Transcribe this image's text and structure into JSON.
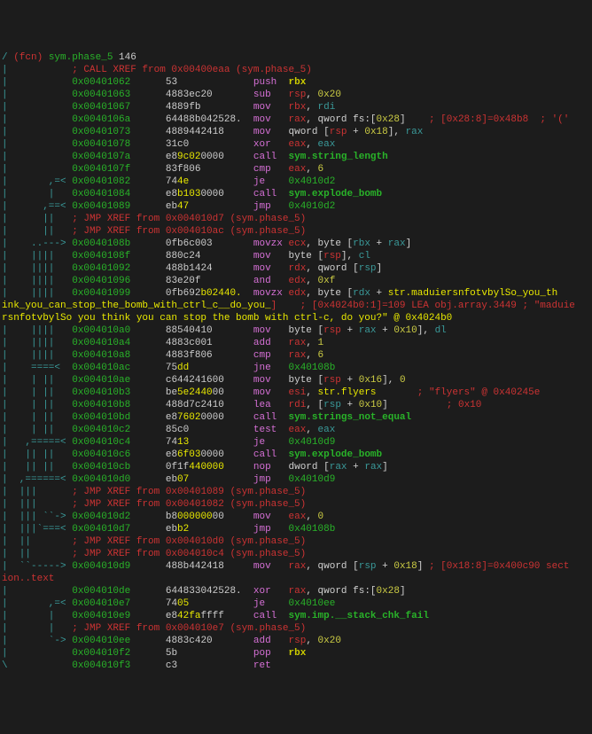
{
  "chart_data": null,
  "lines": [
    {
      "g": "/ ",
      "p": "(fcn) ",
      "nm": "sym.phase_5",
      "sz": " 146",
      "c": "fname"
    },
    {
      "g": "|           ",
      "x": "; CALL XREF from 0x00400eaa (sym.phase_5)",
      "c": "cmt"
    },
    {
      "g": "|           ",
      "a": "0x00401062",
      "h": "53",
      "m": "push",
      "ops": [
        {
          "t": "rbx",
          "c": "bb"
        }
      ]
    },
    {
      "g": "|           ",
      "a": "0x00401063",
      "h": "4883ec20",
      "m": "sub",
      "ops": [
        {
          "t": "rsp",
          "c": "regm"
        },
        {
          "t": ", ",
          "c": "op"
        },
        {
          "t": "0x20",
          "c": "num"
        }
      ]
    },
    {
      "g": "|           ",
      "a": "0x00401067",
      "h": "4889fb",
      "m": "mov",
      "ops": [
        {
          "t": "rbx",
          "c": "regm"
        },
        {
          "t": ", ",
          "c": "op"
        },
        {
          "t": "rdi",
          "c": "reg"
        }
      ]
    },
    {
      "g": "|           ",
      "a": "0x0040106a",
      "h": "64488b042528.",
      "m": "mov",
      "ops": [
        {
          "t": "rax",
          "c": "regm"
        },
        {
          "t": ", qword fs:[",
          "c": "op"
        },
        {
          "t": "0x28",
          "c": "num"
        },
        {
          "t": "]",
          "c": "op"
        }
      ],
      "cm": "    ; [0x28:8]=0x48b8  ; '('"
    },
    {
      "g": "|           ",
      "a": "0x00401073",
      "h": "4889442418",
      "m": "mov",
      "ops": [
        {
          "t": "qword [",
          "c": "op"
        },
        {
          "t": "rsp",
          "c": "regm"
        },
        {
          "t": " + ",
          "c": "op"
        },
        {
          "t": "0x18",
          "c": "num"
        },
        {
          "t": "], ",
          "c": "op"
        },
        {
          "t": "rax",
          "c": "reg"
        }
      ]
    },
    {
      "g": "|           ",
      "a": "0x00401078",
      "h": "31c0",
      "m": "xor",
      "ops": [
        {
          "t": "eax",
          "c": "regm"
        },
        {
          "t": ", ",
          "c": "op"
        },
        {
          "t": "eax",
          "c": "reg"
        }
      ]
    },
    {
      "g": "|           ",
      "a": "0x0040107a",
      "h": "e8",
      "h2": "9c02",
      "h3": "0000",
      "m": "call",
      "ops": [
        {
          "t": "sym.string_length",
          "c": "call"
        }
      ]
    },
    {
      "g": "|           ",
      "a": "0x0040107f",
      "h": "83f806",
      "m": "cmp",
      "ops": [
        {
          "t": "eax",
          "c": "regm"
        },
        {
          "t": ", ",
          "c": "op"
        },
        {
          "t": "6",
          "c": "num"
        }
      ]
    },
    {
      "g": "|       ,=< ",
      "a": "0x00401082",
      "h": "74",
      "h2": "4e",
      "m": "je",
      "ops": [
        {
          "t": "0x4010d2",
          "c": "jmp"
        }
      ]
    },
    {
      "g": "|       |   ",
      "a": "0x00401084",
      "h": "e8",
      "h2": "b103",
      "h3": "0000",
      "m": "call",
      "ops": [
        {
          "t": "sym.explode_bomb",
          "c": "call"
        }
      ]
    },
    {
      "g": "|      ,==< ",
      "a": "0x00401089",
      "h": "eb",
      "h2": "47",
      "m": "jmp",
      "ops": [
        {
          "t": "0x4010d2",
          "c": "jmp"
        }
      ]
    },
    {
      "g": "|      ||   ",
      "x": "; JMP XREF from 0x004010d7 (sym.phase_5)",
      "c": "cmt"
    },
    {
      "g": "|      ||   ",
      "x": "; JMP XREF from 0x004010ac (sym.phase_5)",
      "c": "cmt"
    },
    {
      "g": "|    ..---> ",
      "a": "0x0040108b",
      "h": "0fb6c003",
      "m": "movzx",
      "ops": [
        {
          "t": "ecx",
          "c": "regm"
        },
        {
          "t": ", byte [",
          "c": "op"
        },
        {
          "t": "rbx",
          "c": "reg"
        },
        {
          "t": " + ",
          "c": "op"
        },
        {
          "t": "rax",
          "c": "reg"
        },
        {
          "t": "]",
          "c": "op"
        }
      ]
    },
    {
      "g": "|    ||||   ",
      "a": "0x0040108f",
      "h": "880c24",
      "m": "mov",
      "ops": [
        {
          "t": "byte [",
          "c": "op"
        },
        {
          "t": "rsp",
          "c": "regm"
        },
        {
          "t": "], ",
          "c": "op"
        },
        {
          "t": "cl",
          "c": "reg"
        }
      ]
    },
    {
      "g": "|    ||||   ",
      "a": "0x00401092",
      "h": "488b1424",
      "m": "mov",
      "ops": [
        {
          "t": "rdx",
          "c": "regm"
        },
        {
          "t": ", qword [",
          "c": "op"
        },
        {
          "t": "rsp",
          "c": "reg"
        },
        {
          "t": "]",
          "c": "op"
        }
      ]
    },
    {
      "g": "|    ||||   ",
      "a": "0x00401096",
      "h": "83e20f",
      "m": "and",
      "ops": [
        {
          "t": "edx",
          "c": "regm"
        },
        {
          "t": ", ",
          "c": "op"
        },
        {
          "t": "0xf",
          "c": "num"
        }
      ]
    },
    {
      "g": "|    ||||   ",
      "a": "0x00401099",
      "h": "0fb692",
      "h2": "b02440.",
      "m": "movzx",
      "ops": [
        {
          "t": "edx",
          "c": "regm"
        },
        {
          "t": ", byte [",
          "c": "op"
        },
        {
          "t": "rdx",
          "c": "reg"
        },
        {
          "t": " + ",
          "c": "op"
        },
        {
          "t": "str.maduiersnfotvbylSo_you_th",
          "c": "str"
        }
      ]
    },
    {
      "raw1": "ink_you_can_stop_the_bomb_with_ctrl_c__do_you_",
      "raw2": "]    ; [0x4024b0:1]=109 LEA obj.array.3449 ; \"maduie"
    },
    {
      "raw1": "rsnfotvbylSo you think you can stop the bomb with ctrl-c, do you?\" @ 0x4024b0"
    },
    {
      "g": "|    ||||   ",
      "a": "0x004010a0",
      "h": "88540410",
      "m": "mov",
      "ops": [
        {
          "t": "byte [",
          "c": "op"
        },
        {
          "t": "rsp",
          "c": "regm"
        },
        {
          "t": " + ",
          "c": "op"
        },
        {
          "t": "rax",
          "c": "reg"
        },
        {
          "t": " + ",
          "c": "op"
        },
        {
          "t": "0x10",
          "c": "num"
        },
        {
          "t": "], ",
          "c": "op"
        },
        {
          "t": "dl",
          "c": "reg"
        }
      ]
    },
    {
      "g": "|    ||||   ",
      "a": "0x004010a4",
      "h": "4883c001",
      "m": "add",
      "ops": [
        {
          "t": "rax",
          "c": "regm"
        },
        {
          "t": ", ",
          "c": "op"
        },
        {
          "t": "1",
          "c": "num"
        }
      ]
    },
    {
      "g": "|    ||||   ",
      "a": "0x004010a8",
      "h": "4883f806",
      "m": "cmp",
      "ops": [
        {
          "t": "rax",
          "c": "regm"
        },
        {
          "t": ", ",
          "c": "op"
        },
        {
          "t": "6",
          "c": "num"
        }
      ]
    },
    {
      "g": "|    ====<  ",
      "a": "0x004010ac",
      "h": "75",
      "h2": "dd",
      "m": "jne",
      "ops": [
        {
          "t": "0x40108b",
          "c": "jmp"
        }
      ]
    },
    {
      "g": "|    | ||   ",
      "a": "0x004010ae",
      "h": "c644241600",
      "m": "mov",
      "ops": [
        {
          "t": "byte [",
          "c": "op"
        },
        {
          "t": "rsp",
          "c": "regm"
        },
        {
          "t": " + ",
          "c": "op"
        },
        {
          "t": "0x16",
          "c": "num"
        },
        {
          "t": "], ",
          "c": "op"
        },
        {
          "t": "0",
          "c": "num"
        }
      ]
    },
    {
      "g": "|    | ||   ",
      "a": "0x004010b3",
      "h": "be",
      "h2": "5e2440",
      "h3": "00",
      "m": "mov",
      "ops": [
        {
          "t": "esi",
          "c": "regm"
        },
        {
          "t": ", ",
          "c": "op"
        },
        {
          "t": "str.flyers",
          "c": "str"
        }
      ],
      "cm": "       ; \"flyers\" @ 0x40245e"
    },
    {
      "g": "|    | ||   ",
      "a": "0x004010b8",
      "h": "488d7c2410",
      "m": "lea",
      "ops": [
        {
          "t": "rdi",
          "c": "regm"
        },
        {
          "t": ", [",
          "c": "op"
        },
        {
          "t": "rsp",
          "c": "reg"
        },
        {
          "t": " + ",
          "c": "op"
        },
        {
          "t": "0x10",
          "c": "num"
        },
        {
          "t": "]",
          "c": "op"
        }
      ],
      "cm": "          ; 0x10"
    },
    {
      "g": "|    | ||   ",
      "a": "0x004010bd",
      "h": "e8",
      "h2": "7602",
      "h3": "0000",
      "m": "call",
      "ops": [
        {
          "t": "sym.strings_not_equal",
          "c": "call"
        }
      ]
    },
    {
      "g": "|    | ||   ",
      "a": "0x004010c2",
      "h": "85c0",
      "m": "test",
      "ops": [
        {
          "t": "eax",
          "c": "regm"
        },
        {
          "t": ", ",
          "c": "op"
        },
        {
          "t": "eax",
          "c": "reg"
        }
      ]
    },
    {
      "g": "|   ,=====< ",
      "a": "0x004010c4",
      "h": "74",
      "h2": "13",
      "m": "je",
      "ops": [
        {
          "t": "0x4010d9",
          "c": "jmp"
        }
      ]
    },
    {
      "g": "|   || ||   ",
      "a": "0x004010c6",
      "h": "e8",
      "h2": "6f03",
      "h3": "0000",
      "m": "call",
      "ops": [
        {
          "t": "sym.explode_bomb",
          "c": "call"
        }
      ]
    },
    {
      "g": "|   || ||   ",
      "a": "0x004010cb",
      "h": "0f1f",
      "h2": "440000",
      "m": "nop",
      "ops": [
        {
          "t": "dword [",
          "c": "op"
        },
        {
          "t": "rax",
          "c": "reg"
        },
        {
          "t": " + ",
          "c": "op"
        },
        {
          "t": "rax",
          "c": "reg"
        },
        {
          "t": "]",
          "c": "op"
        }
      ]
    },
    {
      "g": "|  ,======< ",
      "a": "0x004010d0",
      "h": "eb",
      "h2": "07",
      "m": "jmp",
      "ops": [
        {
          "t": "0x4010d9",
          "c": "jmp"
        }
      ]
    },
    {
      "g": "|  |||      ",
      "x": "; JMP XREF from 0x00401089 (sym.phase_5)",
      "c": "cmt"
    },
    {
      "g": "|  |||      ",
      "x": "; JMP XREF from 0x00401082 (sym.phase_5)",
      "c": "cmt"
    },
    {
      "g": "|  ||| ``-> ",
      "a": "0x004010d2",
      "h": "b8",
      "h2": "000000",
      "h3": "00",
      "m": "mov",
      "ops": [
        {
          "t": "eax",
          "c": "regm"
        },
        {
          "t": ", ",
          "c": "op"
        },
        {
          "t": "0",
          "c": "num"
        }
      ]
    },
    {
      "g": "|  |||`===< ",
      "a": "0x004010d7",
      "h": "eb",
      "h2": "b2",
      "m": "jmp",
      "ops": [
        {
          "t": "0x40108b",
          "c": "jmp"
        }
      ]
    },
    {
      "g": "|  ||       ",
      "x": "; JMP XREF from 0x004010d0 (sym.phase_5)",
      "c": "cmt"
    },
    {
      "g": "|  ||       ",
      "x": "; JMP XREF from 0x004010c4 (sym.phase_5)",
      "c": "cmt"
    },
    {
      "g": "|  ``-----> ",
      "a": "0x004010d9",
      "h": "488b442418",
      "m": "mov",
      "ops": [
        {
          "t": "rax",
          "c": "regm"
        },
        {
          "t": ", qword [",
          "c": "op"
        },
        {
          "t": "rsp",
          "c": "reg"
        },
        {
          "t": " + ",
          "c": "op"
        },
        {
          "t": "0x18",
          "c": "num"
        },
        {
          "t": "]",
          "c": "op"
        }
      ],
      "cm": " ; [0x18:8]=0x400c90 sect"
    },
    {
      "rawp": "ion..text"
    },
    {
      "g": "|           ",
      "a": "0x004010de",
      "h": "644833042528.",
      "m": "xor",
      "ops": [
        {
          "t": "rax",
          "c": "regm"
        },
        {
          "t": ", qword fs:[",
          "c": "op"
        },
        {
          "t": "0x28",
          "c": "num"
        },
        {
          "t": "]",
          "c": "op"
        }
      ]
    },
    {
      "g": "|       ,=< ",
      "a": "0x004010e7",
      "h": "74",
      "h2": "05",
      "m": "je",
      "ops": [
        {
          "t": "0x4010ee",
          "c": "jmp"
        }
      ]
    },
    {
      "g": "|       |   ",
      "a": "0x004010e9",
      "h": "e8",
      "h2": "42fa",
      "h3": "ffff",
      "m": "call",
      "ops": [
        {
          "t": "sym.imp.__stack_chk_fail",
          "c": "call"
        }
      ]
    },
    {
      "g": "|       |   ",
      "x": "; JMP XREF from 0x004010e7 (sym.phase_5)",
      "c": "cmt"
    },
    {
      "g": "|       `-> ",
      "a": "0x004010ee",
      "h": "4883c420",
      "m": "add",
      "ops": [
        {
          "t": "rsp",
          "c": "regm"
        },
        {
          "t": ", ",
          "c": "op"
        },
        {
          "t": "0x20",
          "c": "num"
        }
      ]
    },
    {
      "g": "|           ",
      "a": "0x004010f2",
      "h": "5b",
      "m": "pop",
      "ops": [
        {
          "t": "rbx",
          "c": "bb"
        }
      ]
    },
    {
      "g": "\\           ",
      "a": "0x004010f3",
      "h": "c3",
      "m": "ret",
      "ops": []
    }
  ]
}
